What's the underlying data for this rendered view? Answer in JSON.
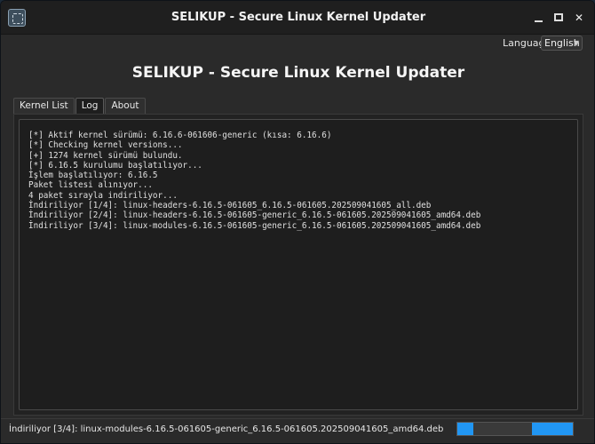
{
  "window": {
    "title": "SELIKUP - Secure Linux Kernel Updater"
  },
  "language": {
    "label": "Language:",
    "selected": "English"
  },
  "header": {
    "title": "SELIKUP - Secure Linux Kernel Updater"
  },
  "tabs": [
    {
      "label": "Kernel List"
    },
    {
      "label": "Log"
    },
    {
      "label": "About"
    }
  ],
  "log": {
    "lines": [
      "[*] Aktif kernel sürümü: 6.16.6-061606-generic (kısa: 6.16.6)",
      "[*] Checking kernel versions...",
      "[+] 1274 kernel sürümü bulundu.",
      "[*] 6.16.5 kurulumu başlatılıyor...",
      "İşlem başlatılıyor: 6.16.5",
      "Paket listesi alınıyor...",
      "4 paket sırayla indiriliyor...",
      "İndiriliyor [1/4]: linux-headers-6.16.5-061605_6.16.5-061605.202509041605_all.deb",
      "İndiriliyor [2/4]: linux-headers-6.16.5-061605-generic_6.16.5-061605.202509041605_amd64.deb",
      "İndiriliyor [3/4]: linux-modules-6.16.5-061605-generic_6.16.5-061605.202509041605_amd64.deb"
    ]
  },
  "status": {
    "text": "İndiriliyor [3/4]: linux-modules-6.16.5-061605-generic_6.16.5-061605.202509041605_amd64.deb",
    "progress_style": "indeterminate"
  },
  "colors": {
    "accent": "#2196f3",
    "background": "#2a2a2a",
    "log_background": "#1e1e1e"
  }
}
